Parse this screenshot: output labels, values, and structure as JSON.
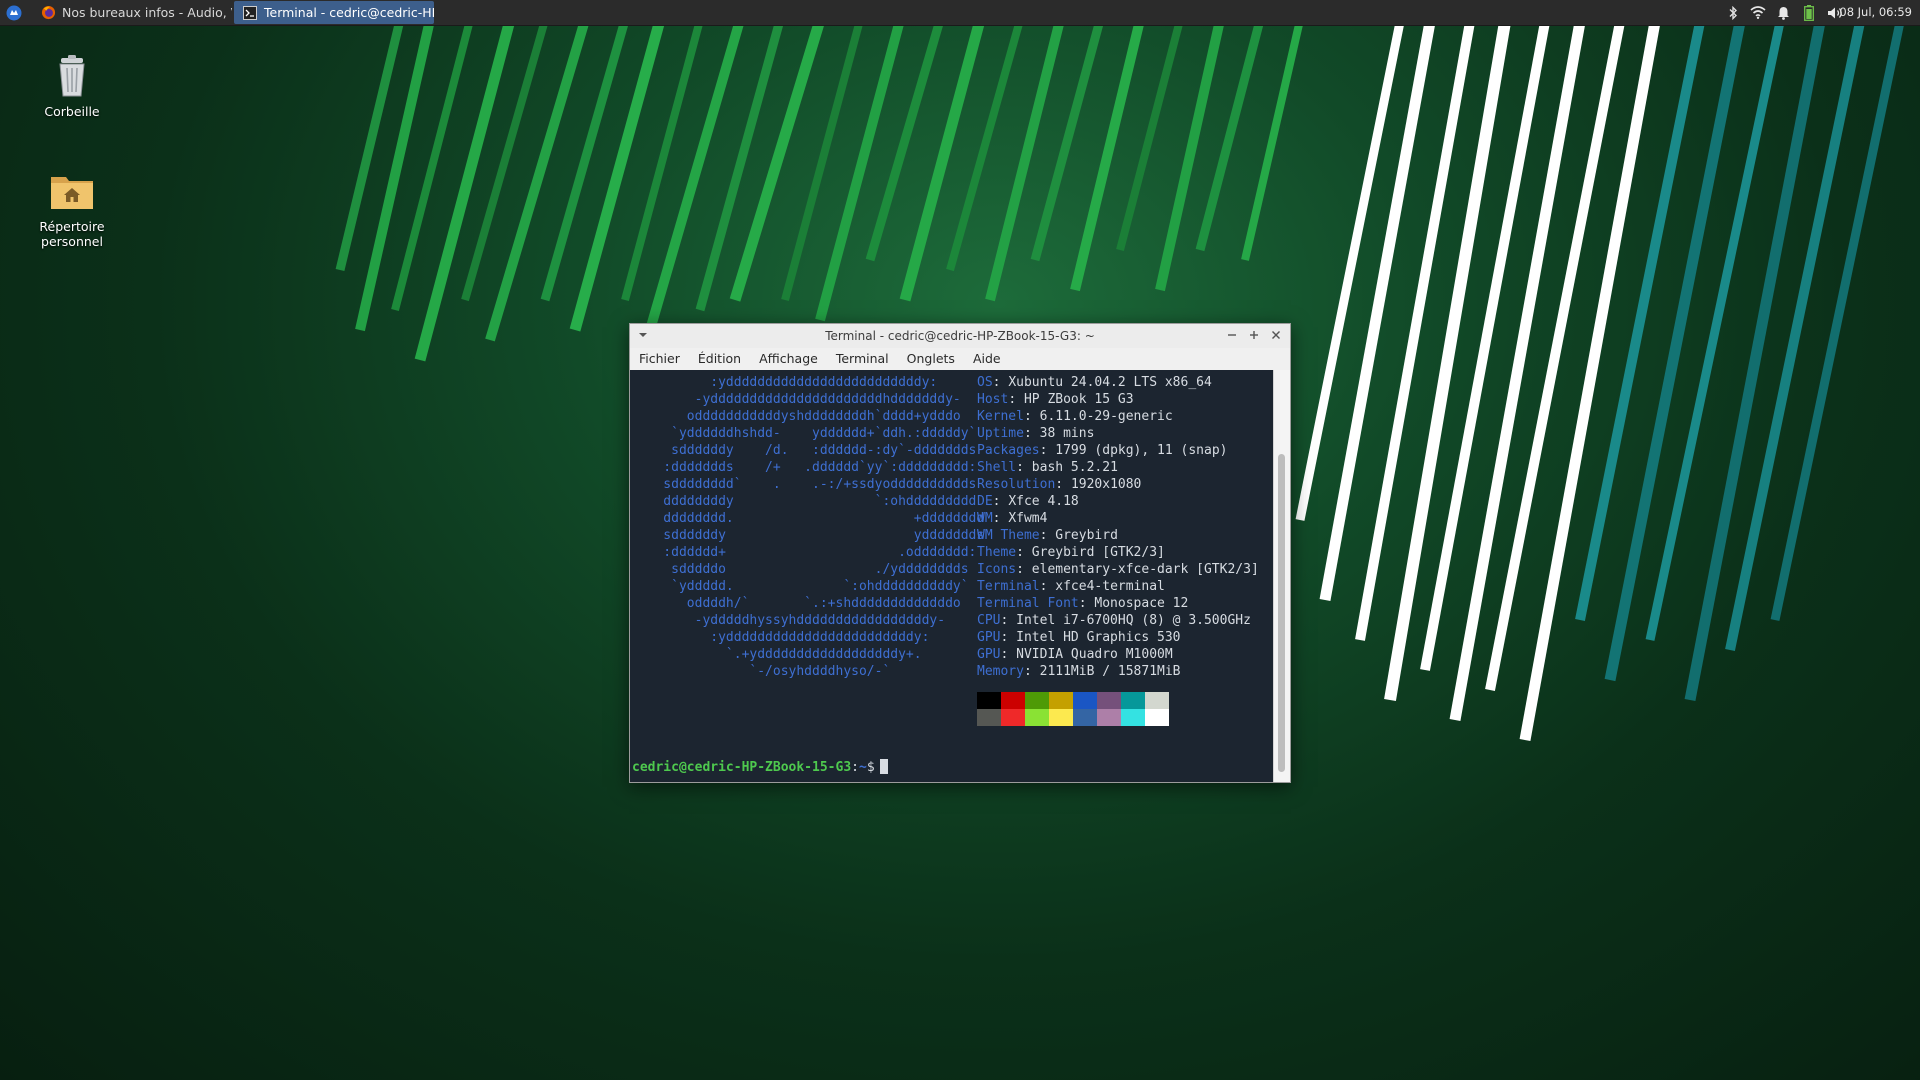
{
  "panel": {
    "tasks": [
      {
        "label": "Nos bureaux infos - Audio, V...",
        "icon": "firefox-icon"
      },
      {
        "label": "Terminal - cedric@cedric-HP...",
        "icon": "terminal-icon"
      }
    ],
    "clock": "08 Jul, 06:59"
  },
  "desktop": {
    "trash_label": "Corbeille",
    "home_label_1": "Répertoire",
    "home_label_2": "personnel"
  },
  "window": {
    "title": "Terminal - cedric@cedric-HP-ZBook-15-G3: ~",
    "menu": [
      "Fichier",
      "Édition",
      "Affichage",
      "Terminal",
      "Onglets",
      "Aide"
    ]
  },
  "terminal": {
    "logo_lines": [
      "          :ydddddddddddddddddddddddddy:",
      "        -yddddddddddddddddddddddhdddddddy-",
      "       odddddddddddyshddddddddh`dddd+ydddo",
      "     `yddddddhshdd-    ydddddd+`ddh.:dddddy`",
      "     sddddddy    /d.   :dddddd-:dy`-ddddddds",
      "    :ddddddds    /+   .dddddd`yy`:ddddddddd:",
      "    sdddddddd`    .    .-:/+ssdyodddddddddds",
      "    ddddddddy                  `:ohddddddddd",
      "    dddddddd.                       +dddddddd",
      "    sddddddy                        yddddddds",
      "    :dddddd+                      .oddddddd:",
      "     sdddddo                   ./ydddddddds",
      "     `yddddd.              `:ohddddddddddy`",
      "       oddddh/`       `.:+shdddddddddddddo",
      "        -ydddddhyssyhdddddddddddddddddy-",
      "          :yddddddddddddddddddddddddy:",
      "            `.+yddddddddddddddddddy+.",
      "               `-/osyhddddhyso/-`"
    ],
    "info": [
      {
        "key": "OS",
        "value": "Xubuntu 24.04.2 LTS x86_64"
      },
      {
        "key": "Host",
        "value": "HP ZBook 15 G3"
      },
      {
        "key": "Kernel",
        "value": "6.11.0-29-generic"
      },
      {
        "key": "Uptime",
        "value": "38 mins"
      },
      {
        "key": "Packages",
        "value": "1799 (dpkg), 11 (snap)"
      },
      {
        "key": "Shell",
        "value": "bash 5.2.21"
      },
      {
        "key": "Resolution",
        "value": "1920x1080"
      },
      {
        "key": "DE",
        "value": "Xfce 4.18"
      },
      {
        "key": "WM",
        "value": "Xfwm4"
      },
      {
        "key": "WM Theme",
        "value": "Greybird"
      },
      {
        "key": "Theme",
        "value": "Greybird [GTK2/3]"
      },
      {
        "key": "Icons",
        "value": "elementary-xfce-dark [GTK2/3]"
      },
      {
        "key": "Terminal",
        "value": "xfce4-terminal"
      },
      {
        "key": "Terminal Font",
        "value": "Monospace 12"
      },
      {
        "key": "CPU",
        "value": "Intel i7-6700HQ (8) @ 3.500GHz"
      },
      {
        "key": "GPU",
        "value": "Intel HD Graphics 530"
      },
      {
        "key": "GPU",
        "value": "NVIDIA Quadro M1000M"
      },
      {
        "key": "Memory",
        "value": "2111MiB / 15871MiB"
      }
    ],
    "palette_row1": [
      "#000000",
      "#cc0000",
      "#4e9a06",
      "#c4a000",
      "#1a56c4",
      "#75507b",
      "#06989a",
      "#d3d7cf"
    ],
    "palette_row2": [
      "#555753",
      "#ef2929",
      "#8ae234",
      "#fce94f",
      "#3465a4",
      "#ad7fa8",
      "#34e2e2",
      "#ffffff"
    ],
    "prompt": {
      "user": "cedric@cedric-HP-ZBook-15-G3",
      "sep": ":",
      "path": "~",
      "symbol": "$"
    }
  }
}
